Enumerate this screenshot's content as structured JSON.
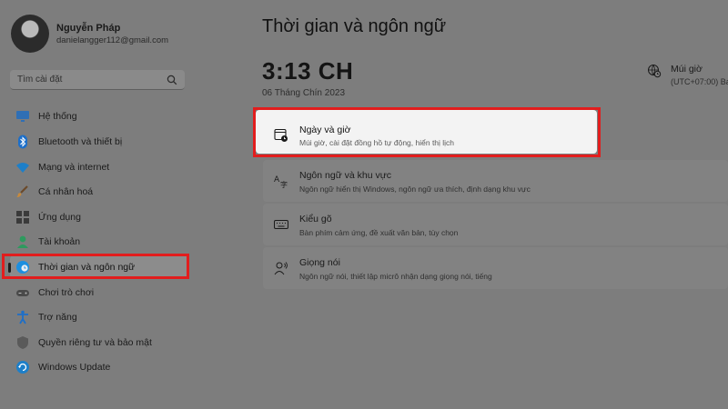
{
  "user": {
    "name": "Nguyễn Pháp",
    "email": "danielangger112@gmail.com"
  },
  "search": {
    "placeholder": "Tìm cài đặt"
  },
  "sidebar": {
    "items": [
      {
        "label": "Hệ thống",
        "icon": "monitor-icon"
      },
      {
        "label": "Bluetooth và thiết bị",
        "icon": "bluetooth-icon"
      },
      {
        "label": "Mạng và internet",
        "icon": "wifi-icon"
      },
      {
        "label": "Cá nhân hoá",
        "icon": "brush-icon"
      },
      {
        "label": "Ứng dụng",
        "icon": "apps-icon"
      },
      {
        "label": "Tài khoản",
        "icon": "user-icon"
      },
      {
        "label": "Thời gian và ngôn ngữ",
        "icon": "globe-clock-icon",
        "active": true
      },
      {
        "label": "Chơi trò chơi",
        "icon": "gamepad-icon"
      },
      {
        "label": "Trợ năng",
        "icon": "accessibility-icon"
      },
      {
        "label": "Quyền riêng tư và bảo mật",
        "icon": "shield-icon"
      },
      {
        "label": "Windows Update",
        "icon": "refresh-icon"
      }
    ]
  },
  "main": {
    "title": "Thời gian và ngôn ngữ",
    "time": "3:13 CH",
    "date": "06 Tháng Chín 2023",
    "timezone": {
      "label": "Múi giờ",
      "value": "(UTC+07:00) Ba"
    },
    "cards": [
      {
        "title": "Ngày và giờ",
        "desc": "Múi giờ, cài đặt đồng hồ tự động, hiển thị lịch",
        "icon": "calendar-clock-icon",
        "highlighted": true
      },
      {
        "title": "Ngôn ngữ và khu vực",
        "desc": "Ngôn ngữ hiển thị Windows, ngôn ngữ ưa thích, định dạng khu vực",
        "icon": "language-icon"
      },
      {
        "title": "Kiểu gõ",
        "desc": "Bàn phím cảm ứng, đề xuất văn bản, tùy chọn",
        "icon": "keyboard-icon"
      },
      {
        "title": "Giọng nói",
        "desc": "Ngôn ngữ nói, thiết lập micrô nhận dạng giọng nói, tiếng",
        "icon": "speech-icon"
      }
    ]
  },
  "colors": {
    "highlight": "#e21d1d",
    "background": "#7d7d7d",
    "accent": "#1d8fe0"
  }
}
